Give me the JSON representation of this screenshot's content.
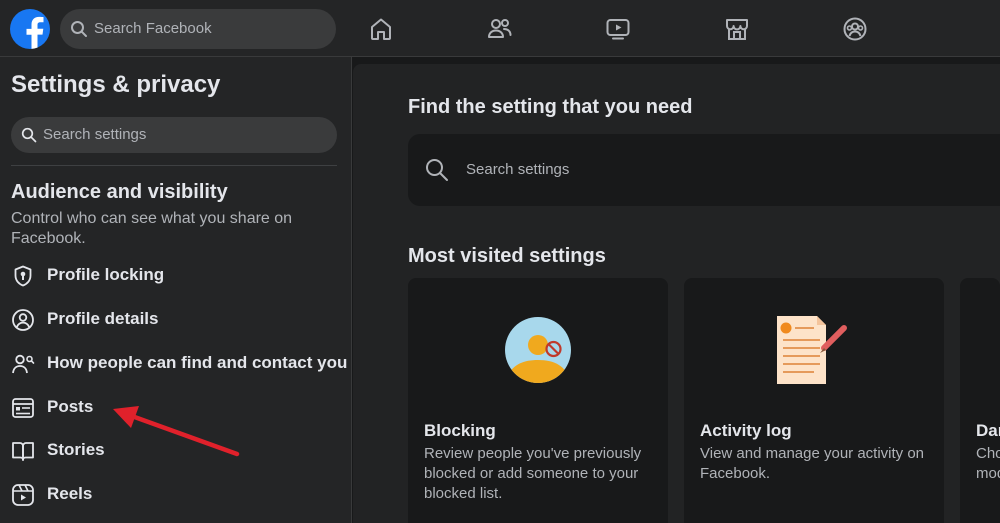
{
  "header": {
    "search_placeholder": "Search Facebook",
    "nav": [
      "home-icon",
      "friends-icon",
      "video-icon",
      "marketplace-icon",
      "groups-icon"
    ],
    "brand_color": "#1877f2"
  },
  "sidebar": {
    "title": "Settings & privacy",
    "search_placeholder": "Search settings",
    "section": {
      "title": "Audience and visibility",
      "description": "Control who can see what you share on Facebook."
    },
    "items": [
      {
        "label": "Profile locking",
        "icon": "shield-lock-icon"
      },
      {
        "label": "Profile details",
        "icon": "person-circle-icon"
      },
      {
        "label": "How people can find and contact you",
        "icon": "people-search-icon"
      },
      {
        "label": "Posts",
        "icon": "posts-icon"
      },
      {
        "label": "Stories",
        "icon": "book-icon"
      },
      {
        "label": "Reels",
        "icon": "reels-icon"
      }
    ]
  },
  "main": {
    "find_title": "Find the setting that you need",
    "search_placeholder": "Search settings",
    "most_visited_title": "Most visited settings",
    "tiles": [
      {
        "title": "Blocking",
        "description": "Review people you've previously blocked or add someone to your blocked list.",
        "icon": "blocking-illustration"
      },
      {
        "title": "Activity log",
        "description": "View and manage your activity on Facebook.",
        "icon": "activity-log-illustration"
      },
      {
        "title": "Dar",
        "description": "Cho mod"
      }
    ]
  },
  "annotation": {
    "color": "#e0212b",
    "icon": "red-arrow"
  }
}
